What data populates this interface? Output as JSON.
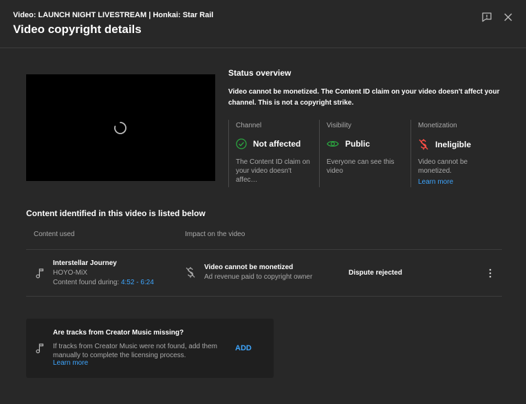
{
  "header": {
    "subtitle": "Video: LAUNCH NIGHT LIVESTREAM | Honkai: Star Rail",
    "title": "Video copyright details"
  },
  "status": {
    "heading": "Status overview",
    "description": "Video cannot be monetized. The Content ID claim on your video doesn't affect your channel. This is not a copyright strike."
  },
  "cards": {
    "channel": {
      "label": "Channel",
      "value": "Not affected",
      "text": "The Content ID claim on your video doesn't affec…",
      "icon": "check-circle-icon",
      "color": "#2ba640"
    },
    "visibility": {
      "label": "Visibility",
      "value": "Public",
      "text": "Everyone can see this video",
      "icon": "eye-icon",
      "color": "#2ba640"
    },
    "monetization": {
      "label": "Monetization",
      "value": "Ineligible",
      "text": "Video cannot be monetized.",
      "link": "Learn more",
      "icon": "no-money-icon",
      "color": "#ff4e45"
    }
  },
  "content": {
    "heading": "Content identified in this video is listed below",
    "columns": [
      "Content used",
      "Impact on the video"
    ],
    "rows": [
      {
        "title": "Interstellar Journey",
        "artist": "HOYO-MiX",
        "found_prefix": "Content found during: ",
        "timestamp": "4:52 - 6:24",
        "impact_title": "Video cannot be monetized",
        "impact_sub": "Ad revenue paid to copyright owner",
        "status": "Dispute rejected"
      }
    ]
  },
  "missing": {
    "title": "Are tracks from Creator Music missing?",
    "text": "If tracks from Creator Music were not found, add them manually to complete the licensing process.",
    "link": "Learn more",
    "action": "ADD"
  },
  "colors": {
    "accent": "#3ea6ff",
    "success": "#2ba640",
    "error": "#ff4e45",
    "background": "#282828"
  }
}
